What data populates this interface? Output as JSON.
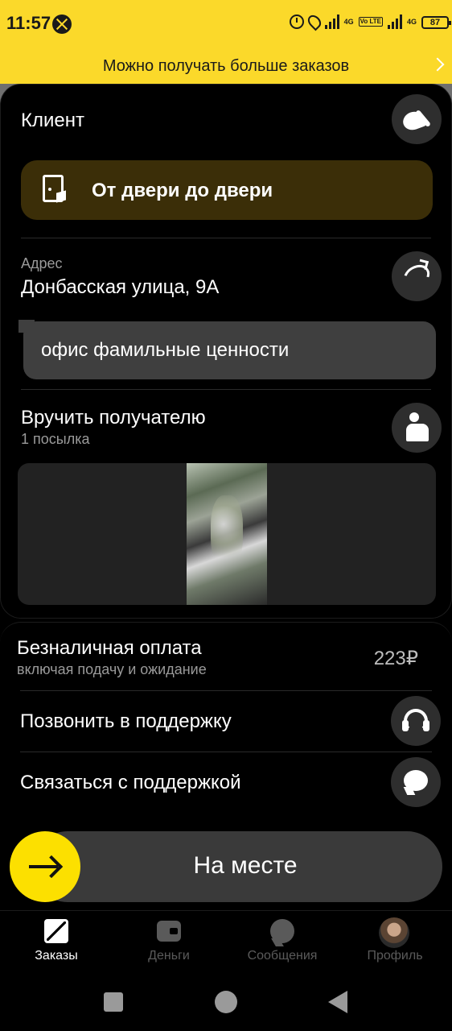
{
  "status_bar": {
    "time": "11:57",
    "network_1": "4G",
    "network_2": "4G",
    "volte": "Vo LTE",
    "battery": "87"
  },
  "banner": {
    "text": "Можно получать больше заказов"
  },
  "order": {
    "client_label": "Клиент",
    "delivery_type": "От двери до двери",
    "address_label": "Адрес",
    "address_value": "Донбасская улица, 9А",
    "comment": "офис фамильные ценности",
    "handover_title": "Вручить получателю",
    "handover_sub": "1 посылка"
  },
  "payment": {
    "title": "Безналичная оплата",
    "subtitle": "включая подачу и ожидание",
    "price": "223₽"
  },
  "support": {
    "call_label": "Позвонить в поддержку",
    "chat_label": "Связаться с поддержкой"
  },
  "action": {
    "arrive_label": "На месте"
  },
  "tabs": [
    {
      "label": "Заказы",
      "icon": "box-icon",
      "active": true
    },
    {
      "label": "Деньги",
      "icon": "wallet-icon",
      "active": false
    },
    {
      "label": "Сообщения",
      "icon": "chat-icon",
      "active": false
    },
    {
      "label": "Профиль",
      "icon": "avatar",
      "active": false
    }
  ],
  "colors": {
    "accent_yellow": "#fce000",
    "banner_yellow": "#fbd92a",
    "background": "#000000",
    "surface": "#2e2e2e"
  }
}
